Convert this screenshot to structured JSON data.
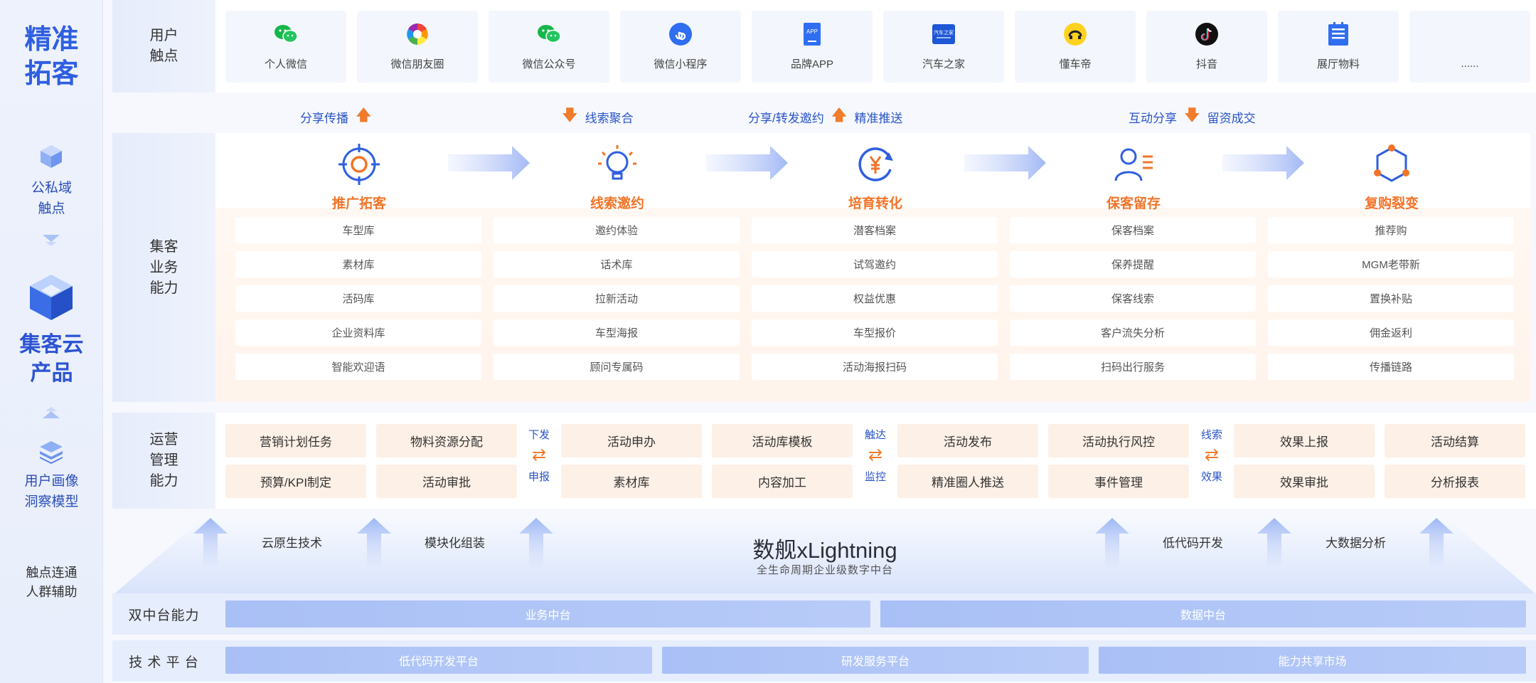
{
  "sidebar": {
    "title_line1": "精准",
    "title_line2": "拓客",
    "domain_line1": "公私域",
    "domain_line2": "触点",
    "product_line1": "集客云",
    "product_line2": "产品",
    "portrait_line1": "用户画像",
    "portrait_line2": "洞察模型",
    "connect_line1": "触点连通",
    "connect_line2": "人群辅助"
  },
  "rows": {
    "touch_line1": "用户",
    "touch_line2": "触点",
    "biz_line1": "集客",
    "biz_line2": "业务",
    "biz_line3": "能力",
    "ops_line1": "运营",
    "ops_line2": "管理",
    "ops_line3": "能力"
  },
  "touchpoints": [
    {
      "label": "个人微信",
      "icon": "wechat-icon"
    },
    {
      "label": "微信朋友圈",
      "icon": "moments-icon"
    },
    {
      "label": "微信公众号",
      "icon": "wechat-icon"
    },
    {
      "label": "微信小程序",
      "icon": "miniprogram-icon"
    },
    {
      "label": "品牌APP",
      "icon": "app-icon",
      "icon_text": "APP"
    },
    {
      "label": "汽车之家",
      "icon": "autohome-icon",
      "icon_text": "汽车之家"
    },
    {
      "label": "懂车帝",
      "icon": "dongchedi-icon"
    },
    {
      "label": "抖音",
      "icon": "douyin-icon"
    },
    {
      "label": "展厅物料",
      "icon": "showroom-icon"
    },
    {
      "label": "......",
      "icon": ""
    }
  ],
  "flows": [
    {
      "label": "分享传播",
      "dir": "up"
    },
    {
      "label": "线索聚合",
      "dir": "down"
    },
    {
      "label_a": "分享/转发邀约",
      "label_b": "精准推送",
      "dir": "up"
    },
    {
      "label_a": "互动分享",
      "label_b": "留资成交",
      "dir": "down"
    }
  ],
  "arrows": {
    "up": "🡅",
    "down": "🡇",
    "swap": "⇄"
  },
  "stages": [
    {
      "label": "推广拓客",
      "items": [
        "车型库",
        "素材库",
        "活码库",
        "企业资料库",
        "智能欢迎语"
      ]
    },
    {
      "label": "线索邀约",
      "items": [
        "邀约体验",
        "话术库",
        "拉新活动",
        "车型海报",
        "顾问专属码"
      ]
    },
    {
      "label": "培育转化",
      "items": [
        "潜客档案",
        "试驾邀约",
        "权益优惠",
        "车型报价",
        "活动海报扫码"
      ]
    },
    {
      "label": "保客留存",
      "items": [
        "保客档案",
        "保养提醒",
        "保客线索",
        "客户流失分析",
        "扫码出行服务"
      ]
    },
    {
      "label": "复购裂变",
      "items": [
        "推荐购",
        "MGM老带新",
        "置换补贴",
        "佣金返利",
        "传播链路"
      ]
    }
  ],
  "ops": {
    "boxes": [
      [
        "营销计划任务",
        "预算/KPI制定"
      ],
      [
        "物料资源分配",
        "活动审批"
      ],
      [
        "活动申办",
        "素材库"
      ],
      [
        "活动库模板",
        "内容加工"
      ],
      [
        "活动发布",
        "精准圈人推送"
      ],
      [
        "活动执行风控",
        "事件管理"
      ],
      [
        "效果上报",
        "效果审批"
      ],
      [
        "活动结算",
        "分析报表"
      ]
    ],
    "seps": [
      {
        "top": "下发",
        "bottom": "申报"
      },
      {
        "top": "触达",
        "bottom": "监控"
      },
      {
        "top": "线索",
        "bottom": "效果"
      }
    ]
  },
  "platform": {
    "title": "数舰xLightning",
    "subtitle": "全生命周期企业级数字中台",
    "techs": [
      "云原生技术",
      "模块化组装",
      "低代码开发",
      "大数据分析"
    ]
  },
  "dual": {
    "label": "双中台能力",
    "bars": [
      "业务中台",
      "数据中台"
    ]
  },
  "tech_platform": {
    "label": "技 术 平 台",
    "bars": [
      "低代码开发平台",
      "研发服务平台",
      "能力共享市场"
    ]
  },
  "colors": {
    "accent_blue": "#2f5fe0",
    "accent_orange": "#f27428",
    "bar_blue": "#a9c0f6"
  }
}
